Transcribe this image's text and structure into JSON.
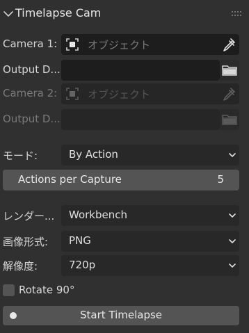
{
  "panel": {
    "title": "Timelapse Cam",
    "chevron_icon": "chevron-down-icon",
    "grip_icon": "drag-grip-icon"
  },
  "camera1": {
    "label": "Camera 1:",
    "placeholder": "オブジェクト",
    "icon": "object-select-icon",
    "eyedropper_icon": "eyedropper-icon"
  },
  "output1": {
    "label": "Output D...",
    "value": "",
    "folder_icon": "folder-icon"
  },
  "camera2": {
    "label": "Camera 2:",
    "placeholder": "オブジェクト",
    "icon": "object-select-icon",
    "eyedropper_icon": "eyedropper-icon",
    "disabled": true
  },
  "output2": {
    "label": "Output D...",
    "value": "",
    "folder_icon": "folder-icon",
    "disabled": true
  },
  "mode": {
    "label": "モード:",
    "value": "By Action"
  },
  "actions_per_capture": {
    "label": "Actions per Capture",
    "value": "5"
  },
  "renderer": {
    "label": "レンダー...",
    "value": "Workbench"
  },
  "image_format": {
    "label": "画像形式:",
    "value": "PNG"
  },
  "resolution": {
    "label": "解像度:",
    "value": "720p"
  },
  "rotate": {
    "label": "Rotate 90°",
    "checked": false
  },
  "start_button": {
    "label": "Start Timelapse",
    "icon": "record-dot-icon"
  },
  "colors": {
    "panel_bg": "#303030",
    "field_bg": "#1d1d1d",
    "button_bg": "#545454",
    "dropdown_bg": "#282828"
  }
}
